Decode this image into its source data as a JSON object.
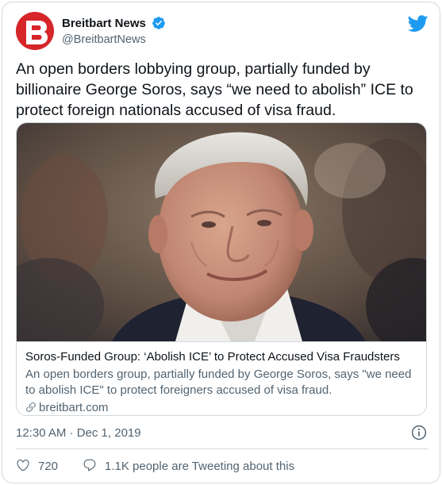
{
  "author": {
    "display_name": "Breitbart News",
    "handle": "@BreitbartNews",
    "avatar_letter": "B",
    "avatar_color": "#d6262a",
    "verified": true
  },
  "tweet": {
    "text": "An open borders lobbying group, partially funded by billionaire George Soros, says “we need to abolish” ICE to protect foreign nationals accused of visa fraud."
  },
  "card": {
    "title": "Soros-Funded Group: ‘Abolish ICE’ to Protect Accused Visa Fraudsters",
    "description": "An open borders group, partially funded by George Soros, says \"we need to abolish ICE\" to protect foreigners accused of visa fraud.",
    "domain": "breitbart.com"
  },
  "meta": {
    "timestamp": "12:30 AM · Dec 1, 2019"
  },
  "actions": {
    "likes": "720",
    "conversation": "1.1K people are Tweeting about this"
  },
  "colors": {
    "twitter_blue": "#1d9bf0",
    "secondary_text": "#536471",
    "border": "#cfd9de"
  }
}
